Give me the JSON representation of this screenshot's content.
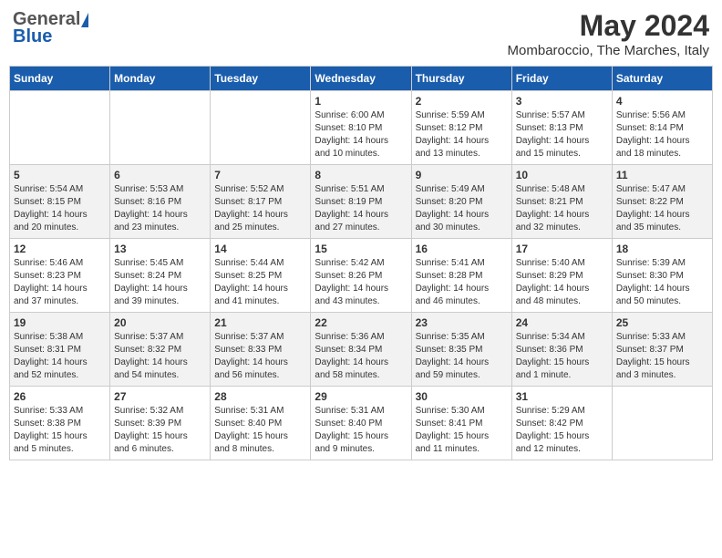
{
  "header": {
    "logo_general": "General",
    "logo_blue": "Blue",
    "month": "May 2024",
    "location": "Mombaroccio, The Marches, Italy"
  },
  "days_of_week": [
    "Sunday",
    "Monday",
    "Tuesday",
    "Wednesday",
    "Thursday",
    "Friday",
    "Saturday"
  ],
  "weeks": [
    [
      {
        "day": "",
        "info": ""
      },
      {
        "day": "",
        "info": ""
      },
      {
        "day": "",
        "info": ""
      },
      {
        "day": "1",
        "info": "Sunrise: 6:00 AM\nSunset: 8:10 PM\nDaylight: 14 hours\nand 10 minutes."
      },
      {
        "day": "2",
        "info": "Sunrise: 5:59 AM\nSunset: 8:12 PM\nDaylight: 14 hours\nand 13 minutes."
      },
      {
        "day": "3",
        "info": "Sunrise: 5:57 AM\nSunset: 8:13 PM\nDaylight: 14 hours\nand 15 minutes."
      },
      {
        "day": "4",
        "info": "Sunrise: 5:56 AM\nSunset: 8:14 PM\nDaylight: 14 hours\nand 18 minutes."
      }
    ],
    [
      {
        "day": "5",
        "info": "Sunrise: 5:54 AM\nSunset: 8:15 PM\nDaylight: 14 hours\nand 20 minutes."
      },
      {
        "day": "6",
        "info": "Sunrise: 5:53 AM\nSunset: 8:16 PM\nDaylight: 14 hours\nand 23 minutes."
      },
      {
        "day": "7",
        "info": "Sunrise: 5:52 AM\nSunset: 8:17 PM\nDaylight: 14 hours\nand 25 minutes."
      },
      {
        "day": "8",
        "info": "Sunrise: 5:51 AM\nSunset: 8:19 PM\nDaylight: 14 hours\nand 27 minutes."
      },
      {
        "day": "9",
        "info": "Sunrise: 5:49 AM\nSunset: 8:20 PM\nDaylight: 14 hours\nand 30 minutes."
      },
      {
        "day": "10",
        "info": "Sunrise: 5:48 AM\nSunset: 8:21 PM\nDaylight: 14 hours\nand 32 minutes."
      },
      {
        "day": "11",
        "info": "Sunrise: 5:47 AM\nSunset: 8:22 PM\nDaylight: 14 hours\nand 35 minutes."
      }
    ],
    [
      {
        "day": "12",
        "info": "Sunrise: 5:46 AM\nSunset: 8:23 PM\nDaylight: 14 hours\nand 37 minutes."
      },
      {
        "day": "13",
        "info": "Sunrise: 5:45 AM\nSunset: 8:24 PM\nDaylight: 14 hours\nand 39 minutes."
      },
      {
        "day": "14",
        "info": "Sunrise: 5:44 AM\nSunset: 8:25 PM\nDaylight: 14 hours\nand 41 minutes."
      },
      {
        "day": "15",
        "info": "Sunrise: 5:42 AM\nSunset: 8:26 PM\nDaylight: 14 hours\nand 43 minutes."
      },
      {
        "day": "16",
        "info": "Sunrise: 5:41 AM\nSunset: 8:28 PM\nDaylight: 14 hours\nand 46 minutes."
      },
      {
        "day": "17",
        "info": "Sunrise: 5:40 AM\nSunset: 8:29 PM\nDaylight: 14 hours\nand 48 minutes."
      },
      {
        "day": "18",
        "info": "Sunrise: 5:39 AM\nSunset: 8:30 PM\nDaylight: 14 hours\nand 50 minutes."
      }
    ],
    [
      {
        "day": "19",
        "info": "Sunrise: 5:38 AM\nSunset: 8:31 PM\nDaylight: 14 hours\nand 52 minutes."
      },
      {
        "day": "20",
        "info": "Sunrise: 5:37 AM\nSunset: 8:32 PM\nDaylight: 14 hours\nand 54 minutes."
      },
      {
        "day": "21",
        "info": "Sunrise: 5:37 AM\nSunset: 8:33 PM\nDaylight: 14 hours\nand 56 minutes."
      },
      {
        "day": "22",
        "info": "Sunrise: 5:36 AM\nSunset: 8:34 PM\nDaylight: 14 hours\nand 58 minutes."
      },
      {
        "day": "23",
        "info": "Sunrise: 5:35 AM\nSunset: 8:35 PM\nDaylight: 14 hours\nand 59 minutes."
      },
      {
        "day": "24",
        "info": "Sunrise: 5:34 AM\nSunset: 8:36 PM\nDaylight: 15 hours\nand 1 minute."
      },
      {
        "day": "25",
        "info": "Sunrise: 5:33 AM\nSunset: 8:37 PM\nDaylight: 15 hours\nand 3 minutes."
      }
    ],
    [
      {
        "day": "26",
        "info": "Sunrise: 5:33 AM\nSunset: 8:38 PM\nDaylight: 15 hours\nand 5 minutes."
      },
      {
        "day": "27",
        "info": "Sunrise: 5:32 AM\nSunset: 8:39 PM\nDaylight: 15 hours\nand 6 minutes."
      },
      {
        "day": "28",
        "info": "Sunrise: 5:31 AM\nSunset: 8:40 PM\nDaylight: 15 hours\nand 8 minutes."
      },
      {
        "day": "29",
        "info": "Sunrise: 5:31 AM\nSunset: 8:40 PM\nDaylight: 15 hours\nand 9 minutes."
      },
      {
        "day": "30",
        "info": "Sunrise: 5:30 AM\nSunset: 8:41 PM\nDaylight: 15 hours\nand 11 minutes."
      },
      {
        "day": "31",
        "info": "Sunrise: 5:29 AM\nSunset: 8:42 PM\nDaylight: 15 hours\nand 12 minutes."
      },
      {
        "day": "",
        "info": ""
      }
    ]
  ]
}
